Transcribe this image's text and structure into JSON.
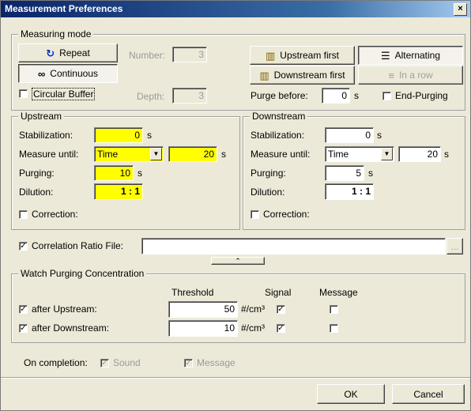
{
  "window": {
    "title": "Measurement Preferences",
    "close_glyph": "×"
  },
  "measuring_mode": {
    "legend": "Measuring mode",
    "repeat_label": "Repeat",
    "continuous_label": "Continuous",
    "circular_buffer_label": "Circular Buffer",
    "number_label": "Number:",
    "number_value": "3",
    "depth_label": "Depth:",
    "depth_value": "3",
    "upstream_first_label": "Upstream first",
    "alternating_label": "Alternating",
    "downstream_first_label": "Downstream first",
    "in_a_row_label": "In a row",
    "purge_before_label": "Purge before:",
    "purge_before_value": "0",
    "purge_before_unit": "s",
    "end_purging_label": "End-Purging"
  },
  "upstream": {
    "legend": "Upstream",
    "stabilization_label": "Stabilization:",
    "stabilization_value": "0",
    "stabilization_unit": "s",
    "measure_until_label": "Measure until:",
    "measure_until_option": "Time",
    "measure_until_value": "20",
    "measure_until_unit": "s",
    "purging_label": "Purging:",
    "purging_value": "10",
    "purging_unit": "s",
    "dilution_label": "Dilution:",
    "dilution_value": "1 : 1",
    "correction_label": "Correction:"
  },
  "downstream": {
    "legend": "Downstream",
    "stabilization_label": "Stabilization:",
    "stabilization_value": "0",
    "stabilization_unit": "s",
    "measure_until_label": "Measure until:",
    "measure_until_option": "Time",
    "measure_until_value": "20",
    "measure_until_unit": "s",
    "purging_label": "Purging:",
    "purging_value": "5",
    "purging_unit": "s",
    "dilution_label": "Dilution:",
    "dilution_value": "1 : 1",
    "correction_label": "Correction:"
  },
  "correlation": {
    "label": "Correlation Ratio File:",
    "value": "",
    "browse_label": "...",
    "collapse_glyph": "⌃"
  },
  "watch_purging": {
    "legend": "Watch Purging Concentration",
    "threshold_header": "Threshold",
    "signal_header": "Signal",
    "message_header": "Message",
    "rows": [
      {
        "label": "after Upstream:",
        "threshold": "50",
        "unit": "#/cm³",
        "checked": true,
        "signal": true,
        "message": false
      },
      {
        "label": "after Downstream:",
        "threshold": "10",
        "unit": "#/cm³",
        "checked": true,
        "signal": true,
        "message": false
      }
    ]
  },
  "completion": {
    "label": "On completion:",
    "sound_label": "Sound",
    "message_label": "Message"
  },
  "buttons": {
    "ok_label": "OK",
    "cancel_label": "Cancel"
  },
  "colors": {
    "highlight": "#ffff00",
    "titlebar": "#0a246a",
    "dialog_bg": "#ece9d8"
  },
  "icons": {
    "repeat": "refresh-icon",
    "continuous": "infinity-icon",
    "upstream_first": "split-pane-icon",
    "alternating": "alternating-lines-icon",
    "downstream_first": "split-pane-icon",
    "in_a_row": "in-a-row-icon"
  }
}
